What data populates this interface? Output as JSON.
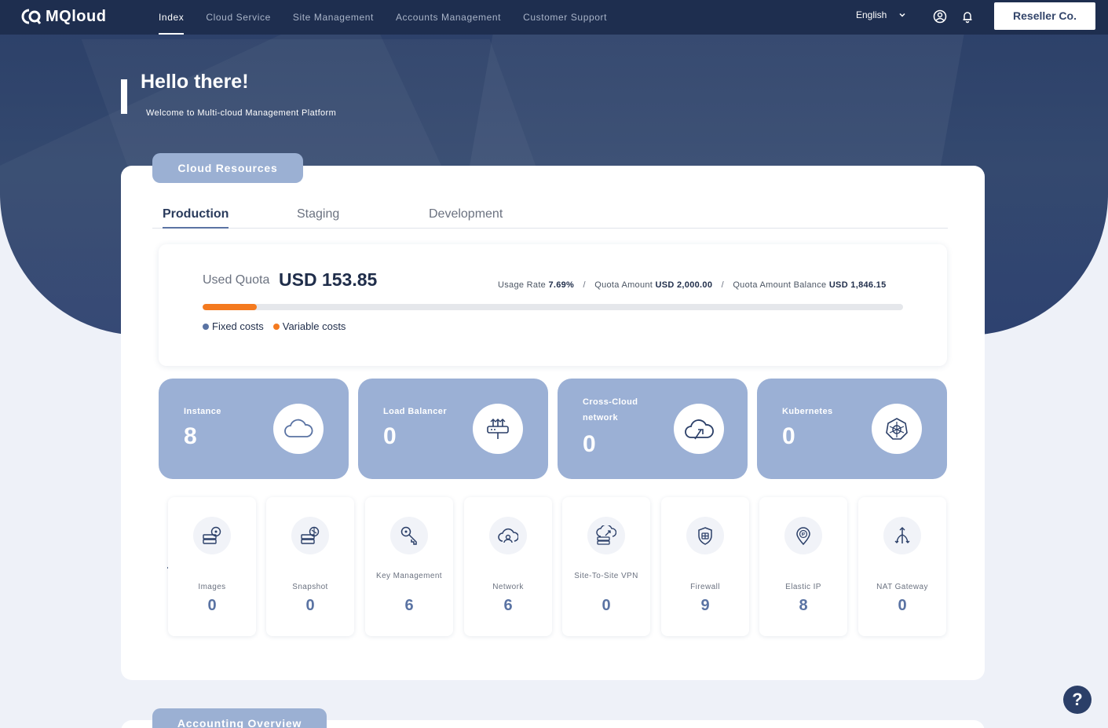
{
  "app": {
    "brand": "MQloud",
    "language": "English",
    "account": "Reseller Co."
  },
  "nav": {
    "items": [
      {
        "label": "Index",
        "active": true
      },
      {
        "label": "Cloud Service",
        "active": false
      },
      {
        "label": "Site Management",
        "active": false
      },
      {
        "label": "Accounts Management",
        "active": false
      },
      {
        "label": "Customer Support",
        "active": false
      }
    ]
  },
  "hero": {
    "title": "Hello there!",
    "subtitle": "Welcome to Multi-cloud Management Platform"
  },
  "cloud_resources": {
    "section_label": "Cloud Resources",
    "tabs": [
      {
        "label": "Production",
        "active": true
      },
      {
        "label": "Staging",
        "active": false
      },
      {
        "label": "Development",
        "active": false
      }
    ],
    "quota": {
      "used_label": "Used Quota",
      "used_value": "USD 153.85",
      "usage_rate_label": "Usage Rate",
      "usage_rate": "7.69%",
      "quota_amount_label": "Quota Amount",
      "quota_amount": "USD 2,000.00",
      "balance_label": "Quota Amount Balance",
      "balance": "USD 1,846.15",
      "separator": "/",
      "progress_fraction": 0.0769,
      "legend": {
        "fixed": "Fixed costs",
        "variable": "Variable costs"
      },
      "colors": {
        "fixed": "#5a73a3",
        "variable": "#f47a1f"
      }
    },
    "resources": [
      {
        "label": "Instance",
        "count": "8",
        "icon": "cloud-icon"
      },
      {
        "label": "Load Balancer",
        "count": "0",
        "icon": "load-balancer-icon"
      },
      {
        "label": "Cross-Cloud network",
        "count": "0",
        "icon": "cross-cloud-icon"
      },
      {
        "label": "Kubernetes",
        "count": "0",
        "icon": "kubernetes-icon"
      }
    ],
    "services": [
      {
        "label": "Images",
        "count": "0",
        "icon": "images-icon"
      },
      {
        "label": "Snapshot",
        "count": "0",
        "icon": "snapshot-icon"
      },
      {
        "label": "Key Management",
        "count": "6",
        "icon": "key-icon"
      },
      {
        "label": "Network",
        "count": "6",
        "icon": "network-icon"
      },
      {
        "label": "Site-To-Site VPN",
        "count": "0",
        "icon": "vpn-icon"
      },
      {
        "label": "Firewall",
        "count": "9",
        "icon": "firewall-icon"
      },
      {
        "label": "Elastic IP",
        "count": "8",
        "icon": "elastic-ip-icon"
      },
      {
        "label": "NAT Gateway",
        "count": "0",
        "icon": "nat-gateway-icon"
      }
    ]
  },
  "accounting": {
    "section_label": "Accounting Overview"
  },
  "help": {
    "label": "?"
  }
}
